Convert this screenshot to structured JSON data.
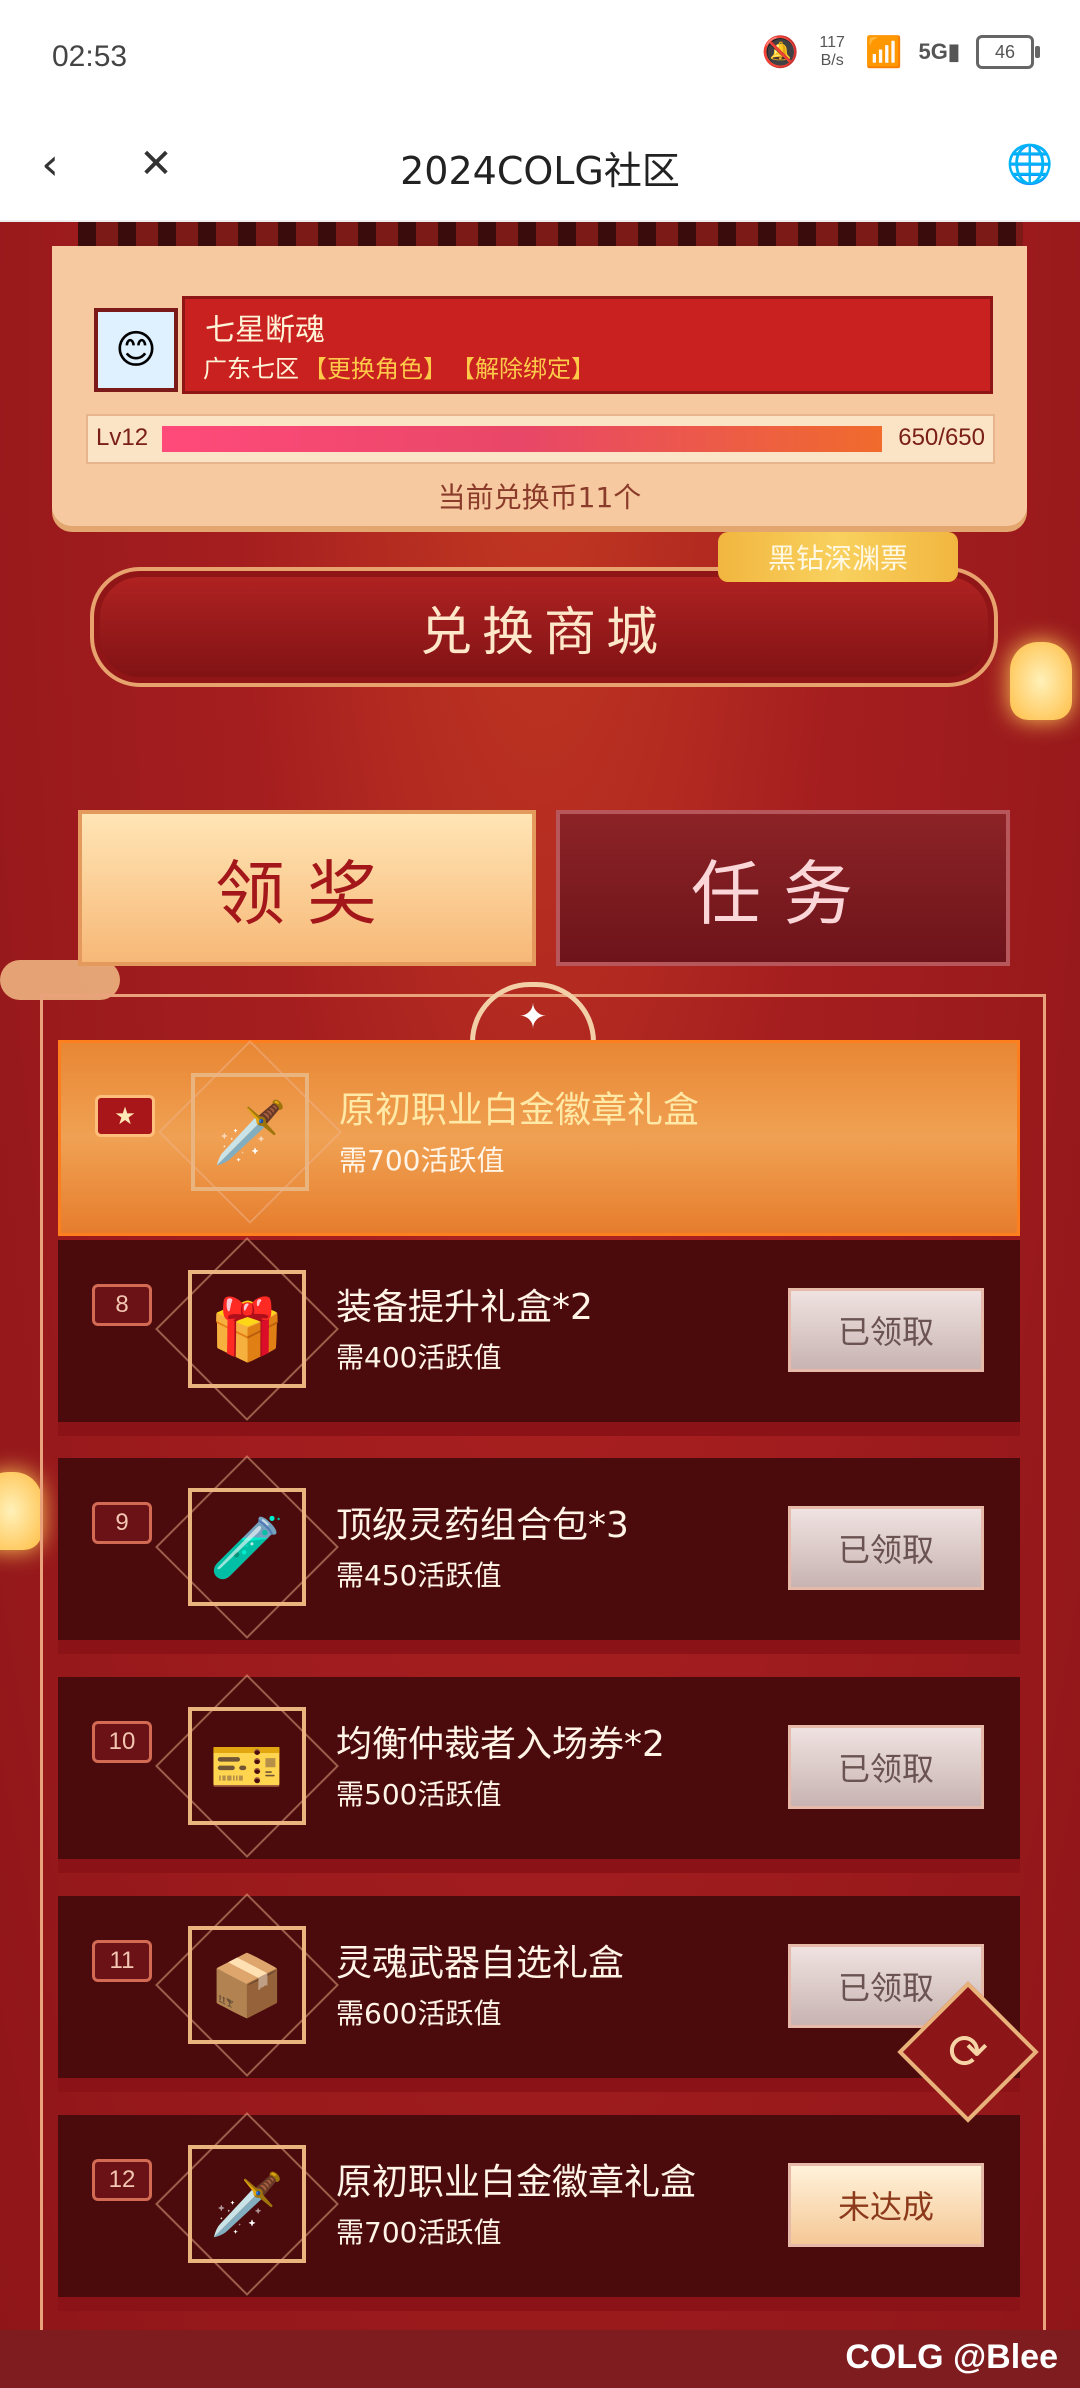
{
  "status_bar": {
    "time": "02:53",
    "speed": "117 B/s",
    "battery": "46",
    "icons": [
      "mute-bell-icon",
      "wifi-icon",
      "signal-5g-icon",
      "battery-icon"
    ]
  },
  "nav": {
    "back_icon": "‹",
    "close_icon": "✕",
    "title": "2024COLG社区",
    "globe_icon": "🌐"
  },
  "profile": {
    "avatar_icon": "😊",
    "name": "七星断魂",
    "server": "广东七区",
    "change_role": "【更换角色】",
    "unbind": "【解除绑定】",
    "level": "Lv12",
    "progress": "650/650",
    "progress_fraction": 1.0,
    "coins_text": "当前兑换币11个"
  },
  "mall": {
    "label": "兑换商城",
    "tag": "黑钻深渊票"
  },
  "tabs": {
    "reward": "领奖",
    "task": "任务"
  },
  "rewards": [
    {
      "num": "★",
      "name": "原初职业白金徽章礼盒",
      "req": "需700活跃值",
      "button": "",
      "icon": "🗡️",
      "highlight": true
    },
    {
      "num": "8",
      "name": "装备提升礼盒*2",
      "req": "需400活跃值",
      "button": "已领取",
      "icon": "🎁",
      "highlight": false
    },
    {
      "num": "9",
      "name": "顶级灵药组合包*3",
      "req": "需450活跃值",
      "button": "已领取",
      "icon": "🧪",
      "highlight": false
    },
    {
      "num": "10",
      "name": "均衡仲裁者入场券*2",
      "req": "需500活跃值",
      "button": "已领取",
      "icon": "🎫",
      "highlight": false
    },
    {
      "num": "11",
      "name": "灵魂武器自选礼盒",
      "req": "需600活跃值",
      "button": "已领取",
      "icon": "📦",
      "highlight": false
    },
    {
      "num": "12",
      "name": "原初职业白金徽章礼盒",
      "req": "需700活跃值",
      "button": "未达成",
      "icon": "🗡️",
      "highlight": false
    }
  ],
  "watermark": "COLG @Blee",
  "colors": {
    "page_bg": "#a11c1e",
    "accent_gold": "#f6c9a0",
    "highlight_row": "#f0a153"
  }
}
